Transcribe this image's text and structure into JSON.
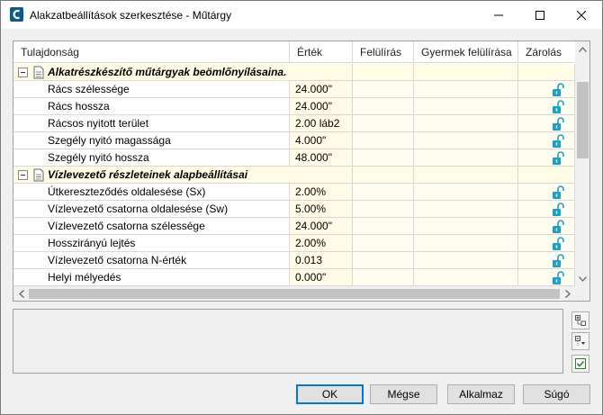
{
  "window": {
    "title": "Alakzatbeállítások szerkesztése - Műtárgy",
    "app_icon": "civil3d-app-icon"
  },
  "grid": {
    "columns": [
      "Tulajdonság",
      "Érték",
      "Felülírás",
      "Gyermek felülírása",
      "Zárolás"
    ],
    "categories": [
      {
        "label": "Alkatrészkészítő műtárgyak beömlőnyílásaina...",
        "rows": [
          {
            "property": "Rács szélessége",
            "value": "24.000\""
          },
          {
            "property": "Rács hossza",
            "value": "24.000\""
          },
          {
            "property": "Rácsos nyitott terület",
            "value": "2.00 láb2"
          },
          {
            "property": "Szegély nyitó magassága",
            "value": "4.000\""
          },
          {
            "property": "Szegély nyitó hossza",
            "value": "48.000\""
          }
        ]
      },
      {
        "label": "Vízlevezető részleteinek alapbeállításai",
        "rows": [
          {
            "property": "Útkereszteződés oldalesése (Sx)",
            "value": "2.00%"
          },
          {
            "property": "Vízlevezető csatorna oldalesése (Sw)",
            "value": "5.00%"
          },
          {
            "property": "Vízlevezető csatorna szélessége",
            "value": "24.000\""
          },
          {
            "property": "Hosszirányú lejtés",
            "value": "2.00%"
          },
          {
            "property": "Vízlevezető csatorna N-érték",
            "value": "0.013"
          },
          {
            "property": "Helyi mélyedés",
            "value": "0.000\""
          }
        ]
      }
    ],
    "lock_icon": "unlocked-padlock-icon",
    "lock_color": "#1ba1c7"
  },
  "side_buttons": [
    "expand-all-icon",
    "collapse-all-icon",
    "checkmark-icon"
  ],
  "buttons": {
    "ok": "OK",
    "cancel": "Mégse",
    "apply": "Alkalmaz",
    "help": "Súgó"
  }
}
